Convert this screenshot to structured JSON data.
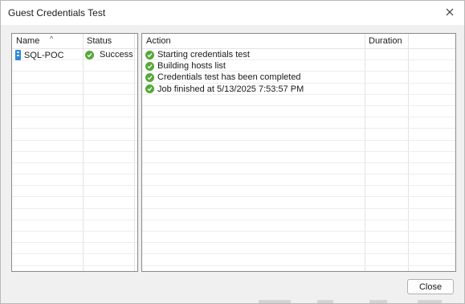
{
  "dialog": {
    "title": "Guest Credentials Test",
    "close_button": "Close"
  },
  "left_table": {
    "columns": [
      "Name",
      "Status"
    ],
    "rows": [
      {
        "name": "SQL-POC",
        "status": "Success"
      }
    ]
  },
  "right_table": {
    "columns": [
      "Action",
      "Duration"
    ],
    "rows": [
      {
        "action": "Starting credentials test",
        "duration": ""
      },
      {
        "action": "Building hosts list",
        "duration": ""
      },
      {
        "action": "Credentials test has been completed",
        "duration": ""
      },
      {
        "action": "Job finished at 5/13/2025 7:53:57 PM",
        "duration": ""
      }
    ]
  },
  "icons": {
    "close": "close-icon",
    "server": "server-icon",
    "status": "check-circle-icon",
    "sort": "sort-up-icon"
  },
  "colors": {
    "success": "#56a83a",
    "server": "#2f88d6"
  }
}
